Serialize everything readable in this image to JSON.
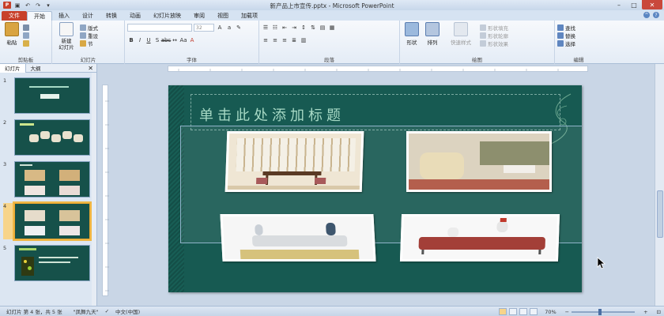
{
  "window": {
    "title": "新产品上市宣传.pptx - Microsoft PowerPoint"
  },
  "ribbon": {
    "tabs": [
      "文件",
      "开始",
      "插入",
      "设计",
      "转换",
      "动画",
      "幻灯片放映",
      "审阅",
      "视图",
      "加载项"
    ],
    "active_tab": "开始",
    "groups": {
      "clipboard": {
        "label": "剪贴板",
        "paste": "粘贴"
      },
      "slides": {
        "label": "幻灯片",
        "new_slide": "新建\n幻灯片",
        "layout": "版式",
        "reset": "重设",
        "section": "节"
      },
      "font": {
        "label": "字体",
        "size": "32"
      },
      "paragraph": {
        "label": "段落"
      },
      "drawing": {
        "label": "绘图",
        "shape": "形状",
        "arrange": "排列",
        "quick_styles": "快速样式",
        "fill": "形状填充",
        "outline": "形状轮廓",
        "effects": "形状效果"
      },
      "editing": {
        "label": "编辑",
        "find": "查找",
        "replace": "替换",
        "select": "选择"
      }
    }
  },
  "pane": {
    "tabs": [
      "幻灯片",
      "大纲"
    ],
    "active_tab": "幻灯片",
    "slides": [
      {
        "num": "1"
      },
      {
        "num": "2"
      },
      {
        "num": "3"
      },
      {
        "num": "4",
        "selected": true
      },
      {
        "num": "5"
      }
    ]
  },
  "slide": {
    "title_placeholder": "单击此处添加标题"
  },
  "status": {
    "slide_info": "幻灯片 第 4 张，共 5 张",
    "theme": "\"凤舞九天\"",
    "language": "中文(中国)",
    "zoom": "70%"
  },
  "colors": {
    "slide_bg": "#175a52",
    "file_tab": "#c8402a",
    "selection": "#f0b745"
  }
}
